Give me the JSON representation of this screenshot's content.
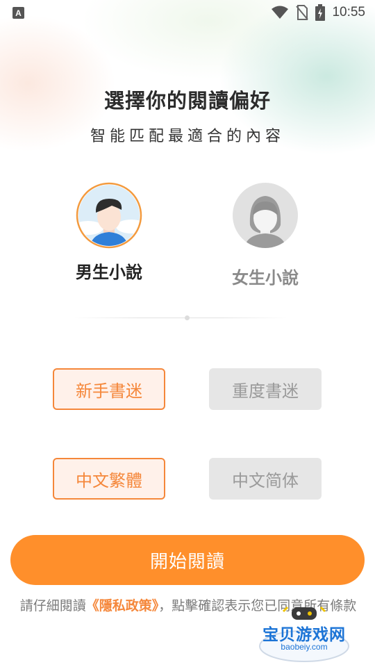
{
  "status_bar": {
    "left_icon": "A",
    "time": "10:55",
    "icons": [
      "wifi-icon",
      "no-sim-icon",
      "battery-charging-icon"
    ]
  },
  "header": {
    "title": "選擇你的閱讀偏好",
    "subtitle": "智能匹配最適合的內容"
  },
  "gender_options": {
    "male_label": "男生小說",
    "female_label": "女生小說",
    "selected": "male"
  },
  "reader_level": {
    "options": [
      "新手書迷",
      "重度書迷"
    ],
    "selected_index": 0
  },
  "script_options": {
    "options": [
      "中文繁體",
      "中文简体"
    ],
    "selected_index": 0
  },
  "start_button": {
    "label": "開始閱讀"
  },
  "notice": {
    "prefix": "請仔細閱讀",
    "policy_link": "《隱私政策》",
    "suffix": "，點擊確認表示您已同意所有條款"
  },
  "watermark": {
    "text": "宝贝游戏网",
    "url": "baobeiy.com"
  },
  "colors": {
    "accent": "#f5873a",
    "button": "#ff8f2b",
    "inactive_bg": "#e6e6e6",
    "inactive_text": "#9a9a9a"
  }
}
